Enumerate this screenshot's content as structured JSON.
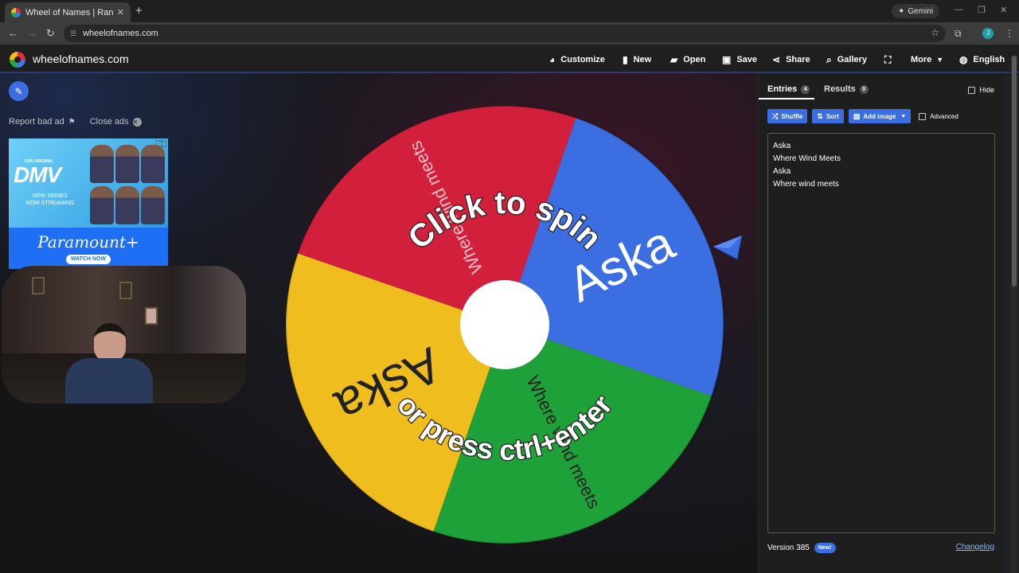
{
  "browser": {
    "tab_title": "Wheel of Names | Random nam",
    "tab_close": "✕",
    "new_tab": "+",
    "gemini_label": "Gemini",
    "url": "wheelofnames.com",
    "profile_initial": "J"
  },
  "header": {
    "site_title": "wheelofnames.com",
    "menu": [
      {
        "label": "Customize",
        "icon": "palette-icon"
      },
      {
        "label": "New",
        "icon": "file-icon"
      },
      {
        "label": "Open",
        "icon": "folder-open-icon"
      },
      {
        "label": "Save",
        "icon": "save-icon"
      },
      {
        "label": "Share",
        "icon": "share-icon"
      },
      {
        "label": "Gallery",
        "icon": "search-icon"
      },
      {
        "label": "",
        "icon": "fullscreen-icon"
      },
      {
        "label": "More",
        "icon": "chevron-down-icon"
      },
      {
        "label": "English",
        "icon": "globe-icon"
      }
    ]
  },
  "ads": {
    "report_label": "Report bad ad",
    "close_label": "Close ads",
    "cbs_label": "CBS ORIGINAL",
    "show_title": "DMV",
    "series_label": "NEW SERIES\nNOW STREAMING",
    "brand": "Paramount+",
    "watch_label": "WATCH NOW"
  },
  "wheel": {
    "segments": [
      {
        "label": "Where wind meets",
        "color": "#d2203c"
      },
      {
        "label": "Aska",
        "color": "#3b6ee0"
      },
      {
        "label": "Where wind meets",
        "color": "#1fa139"
      },
      {
        "label": "Aska",
        "color": "#efbd1e"
      }
    ],
    "overlay_top": "Click to spin",
    "overlay_bottom": "or press ctrl+enter"
  },
  "panel": {
    "entries_tab": "Entries",
    "entries_count": "4",
    "results_tab": "Results",
    "results_count": "0",
    "hide_label": "Hide",
    "shuffle_label": "Shuffle",
    "sort_label": "Sort",
    "add_image_label": "Add image",
    "advanced_label": "Advanced",
    "entries": [
      "Aska",
      "Where Wind Meets",
      "Aska",
      "Where wind meets"
    ],
    "version": "Version 385",
    "new_badge": "New!",
    "changelog": "Changelog"
  }
}
